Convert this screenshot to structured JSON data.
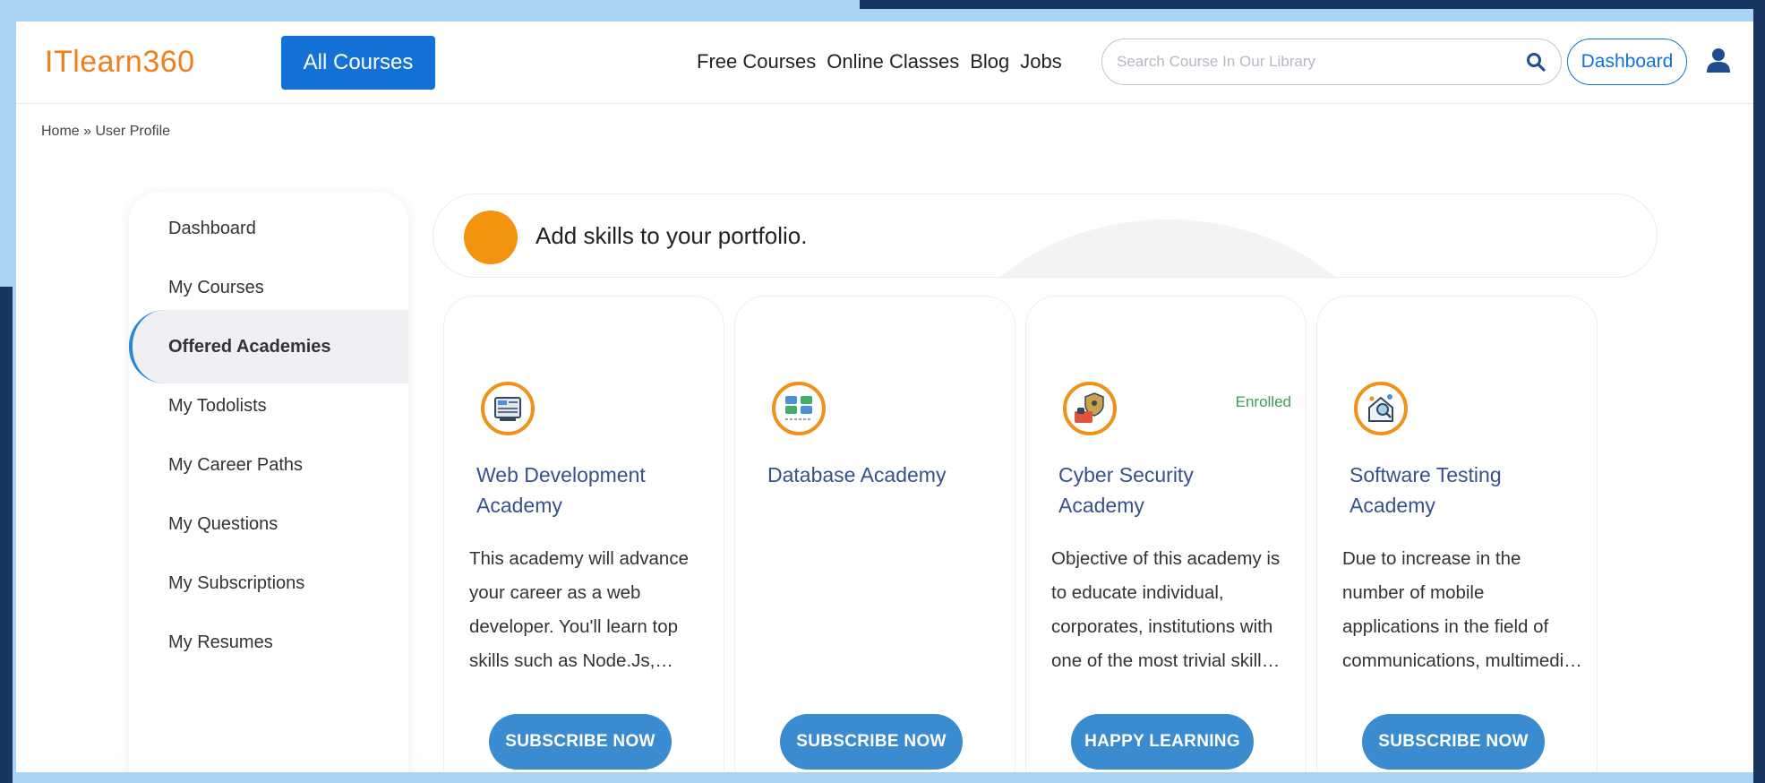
{
  "header": {
    "logo": "ITlearn360",
    "all_courses_label": "All Courses",
    "nav": [
      "Free Courses",
      "Online Classes",
      "Blog",
      "Jobs"
    ],
    "search_placeholder": "Search Course In Our Library",
    "dashboard_label": "Dashboard"
  },
  "breadcrumb": "Home » User Profile",
  "sidebar": {
    "items": [
      {
        "label": "Dashboard"
      },
      {
        "label": "My Courses"
      },
      {
        "label": "Offered Academies",
        "active": true
      },
      {
        "label": "My Todolists"
      },
      {
        "label": "My Career Paths"
      },
      {
        "label": "My Questions"
      },
      {
        "label": "My Subscriptions"
      },
      {
        "label": "My Resumes"
      }
    ]
  },
  "banner": {
    "text": "Add skills to your portfolio."
  },
  "academies": [
    {
      "title": "Web Development Academy",
      "description": "This academy will advance your career as a web developer. You'll learn top skills such as Node.Js, Angular, and…",
      "badge": "",
      "button": "SUBSCRIBE NOW",
      "icon": "web-development-icon"
    },
    {
      "title": "Database Academy",
      "description": "",
      "badge": "",
      "button": "SUBSCRIBE NOW",
      "icon": "database-icon"
    },
    {
      "title": "Cyber Security Academy",
      "description": "Objective of this academy is to educate individual, corporates, institutions with one of the most trivial skill a…",
      "badge": "Enrolled",
      "button": "HAPPY LEARNING",
      "icon": "cyber-security-icon"
    },
    {
      "title": "Software Testing Academy",
      "description": "Due to increase in the number of mobile applications in the field of communications, multimedia travel, an…",
      "badge": "",
      "button": "SUBSCRIBE NOW",
      "icon": "software-testing-icon"
    }
  ],
  "colors": {
    "brand_orange": "#ef7f1a",
    "primary_blue": "#1472d6",
    "card_button": "#3a8bd0",
    "title_blue": "#37518c",
    "enrolled_green": "#3c9d54"
  }
}
